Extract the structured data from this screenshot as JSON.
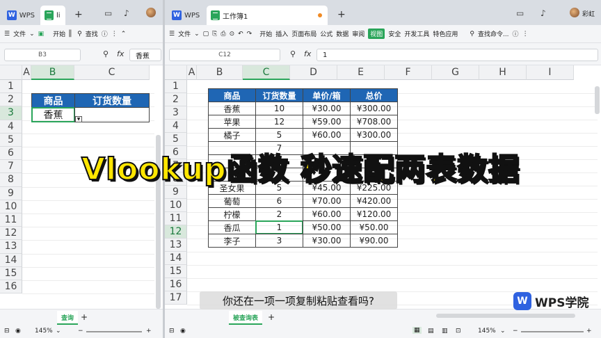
{
  "left_window": {
    "tabs": {
      "wps": "WPS",
      "doc": "li"
    },
    "menu": {
      "file": "文件",
      "start": "开始",
      "find": "查找"
    },
    "name_box": "B3",
    "fx": "fx",
    "formula_value": "香蕉",
    "col_headers": [
      "A",
      "B",
      "C"
    ],
    "row_headers": [
      "1",
      "2",
      "3",
      "4",
      "5",
      "6",
      "7",
      "8",
      "9",
      "10",
      "11",
      "12",
      "13",
      "14",
      "15",
      "16"
    ],
    "table_headers": [
      "商品",
      "订货数量"
    ],
    "table_row": [
      "香蕉",
      ""
    ],
    "sheet_tab": "查询",
    "zoom": "145%"
  },
  "right_window": {
    "tabs": {
      "wps": "WPS",
      "doc": "工作簿1"
    },
    "user": "彩虹",
    "menu": {
      "file": "文件",
      "items": [
        "开始",
        "插入",
        "页面布局",
        "公式",
        "数据",
        "审阅",
        "视图",
        "安全",
        "开发工具",
        "特色应用"
      ],
      "active": "视图",
      "find": "查找命令..."
    },
    "name_box": "C12",
    "fx": "fx",
    "formula_value": "1",
    "col_headers": [
      "A",
      "B",
      "C",
      "D",
      "E",
      "F",
      "G",
      "H",
      "I"
    ],
    "row_headers": [
      "1",
      "2",
      "3",
      "4",
      "5",
      "6",
      "7",
      "8",
      "9",
      "10",
      "11",
      "12",
      "13",
      "14",
      "15",
      "16",
      "17"
    ],
    "table_headers": [
      "商品",
      "订货数量",
      "单价/箱",
      "总价"
    ],
    "table_rows": [
      [
        "香蕉",
        "10",
        "¥30.00",
        "¥300.00"
      ],
      [
        "苹果",
        "12",
        "¥59.00",
        "¥708.00"
      ],
      [
        "橘子",
        "5",
        "¥60.00",
        "¥300.00"
      ],
      [
        "",
        "7",
        "",
        ""
      ],
      [
        "",
        "9",
        "",
        ""
      ],
      [
        "",
        "",
        "",
        ""
      ],
      [
        "圣女果",
        "5",
        "¥45.00",
        "¥225.00"
      ],
      [
        "葡萄",
        "6",
        "¥70.00",
        "¥420.00"
      ],
      [
        "柠檬",
        "2",
        "¥60.00",
        "¥120.00"
      ],
      [
        "香瓜",
        "1",
        "¥50.00",
        "¥50.00"
      ],
      [
        "李子",
        "3",
        "¥30.00",
        "¥90.00"
      ]
    ],
    "sheet_tab": "被查询表",
    "zoom": "145%"
  },
  "overlay": {
    "banner": "Vlookup函数 秒速配两表数据",
    "subtitle": "你还在一项一项复制粘贴查看吗?",
    "brand": "WPS学院",
    "brand_icon": "W"
  },
  "colors": {
    "accent_green": "#2aa55a",
    "table_header_blue": "#1f66b4",
    "banner_yellow": "#ffe600",
    "wps_blue": "#2f62e0"
  }
}
